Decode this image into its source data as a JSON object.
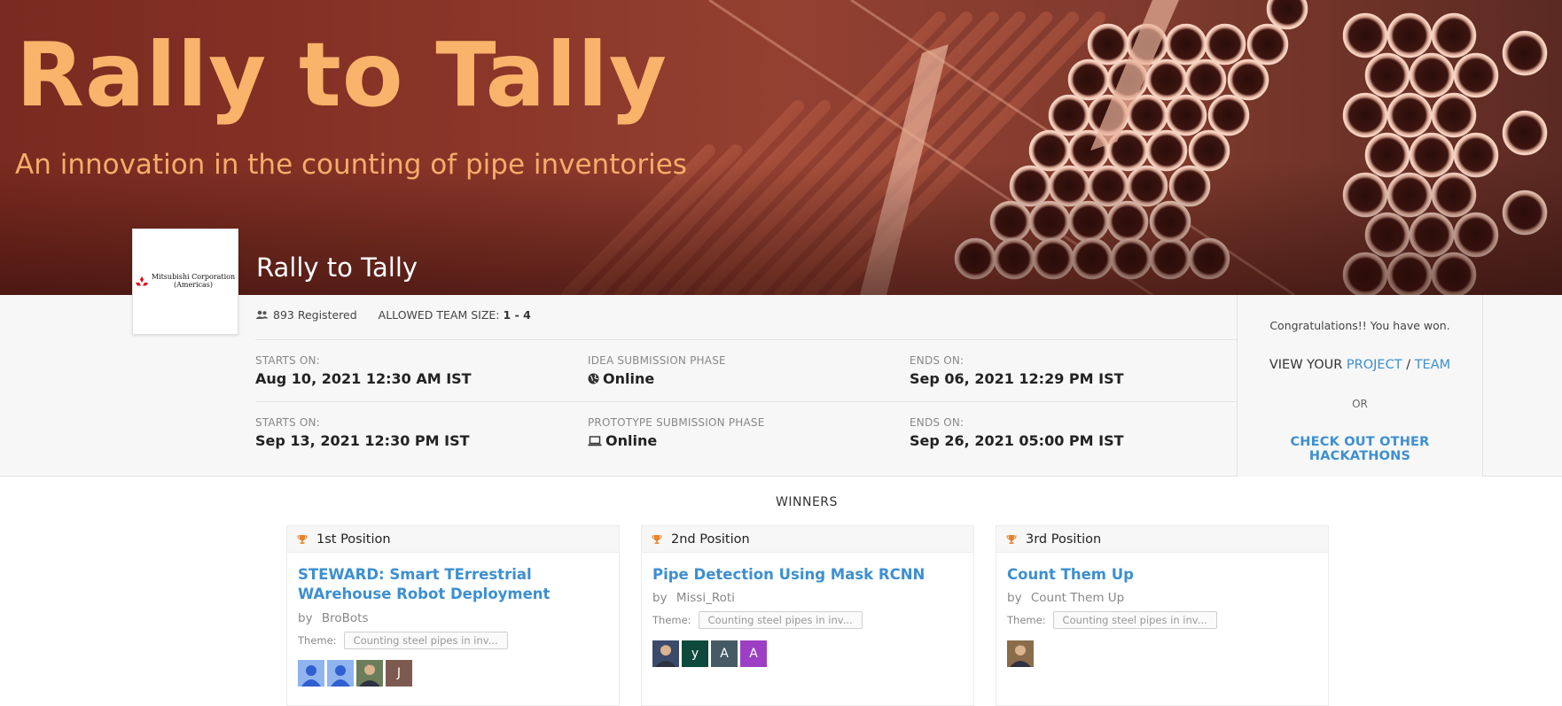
{
  "hero": {
    "title": "Rally to Tally",
    "subtitle": "An innovation in the counting of pipe inventories",
    "page_name": "Rally to Tally"
  },
  "logo": {
    "text_line1": "Mitsubishi Corporation",
    "text_line2": "(Americas)"
  },
  "meta": {
    "registered": "893 Registered",
    "team_size_label": "ALLOWED TEAM SIZE:",
    "team_size_value": "1 - 4"
  },
  "phases": [
    {
      "starts_label": "STARTS ON:",
      "starts_value": "Aug 10, 2021 12:30 AM IST",
      "phase_label": "IDEA SUBMISSION PHASE",
      "phase_mode": "Online",
      "phase_icon": "globe-icon",
      "ends_label": "ENDS ON:",
      "ends_value": "Sep 06, 2021 12:29 PM IST"
    },
    {
      "starts_label": "STARTS ON:",
      "starts_value": "Sep 13, 2021 12:30 PM IST",
      "phase_label": "PROTOTYPE SUBMISSION PHASE",
      "phase_mode": "Online",
      "phase_icon": "laptop-icon",
      "ends_label": "ENDS ON:",
      "ends_value": "Sep 26, 2021 05:00 PM IST"
    }
  ],
  "side": {
    "congrats": "Congratulations!! You have won.",
    "view_prefix": "VIEW YOUR",
    "project_link": "PROJECT",
    "separator": "/",
    "team_link": "TEAM",
    "or": "OR",
    "other_link": "CHECK OUT OTHER HACKATHONS"
  },
  "winners": {
    "heading": "WINNERS",
    "theme_label": "Theme:",
    "by_label": "by",
    "cards": [
      {
        "position": "1st Position",
        "title": "STEWARD: Smart TErrestrial WArehouse Robot Deployment",
        "team": "BroBots",
        "theme": "Counting steel pipes in inv...",
        "avatars": [
          {
            "type": "person",
            "letter": "",
            "color": "#8fb4ee"
          },
          {
            "type": "person",
            "letter": "",
            "color": "#8fb4ee"
          },
          {
            "type": "photo",
            "letter": "",
            "color": "#6b7d5a"
          },
          {
            "type": "letter",
            "letter": "J",
            "color": "#7d5a50"
          }
        ]
      },
      {
        "position": "2nd Position",
        "title": "Pipe Detection Using Mask RCNN",
        "team": "Missi_Roti",
        "theme": "Counting steel pipes in inv...",
        "avatars": [
          {
            "type": "photo",
            "letter": "",
            "color": "#3b4a6b"
          },
          {
            "type": "letter",
            "letter": "y",
            "color": "#0e4a3b"
          },
          {
            "type": "letter",
            "letter": "A",
            "color": "#455a64"
          },
          {
            "type": "letter",
            "letter": "A",
            "color": "#9c3fc4"
          }
        ]
      },
      {
        "position": "3rd Position",
        "title": "Count Them Up",
        "team": "Count Them Up",
        "theme": "Counting steel pipes in inv...",
        "avatars": [
          {
            "type": "photo",
            "letter": "",
            "color": "#8a6b4a"
          }
        ]
      }
    ]
  },
  "colors": {
    "accent_link": "#3d8fd1",
    "hero_title": "#f9b36a",
    "trophy": "#e8832a"
  }
}
